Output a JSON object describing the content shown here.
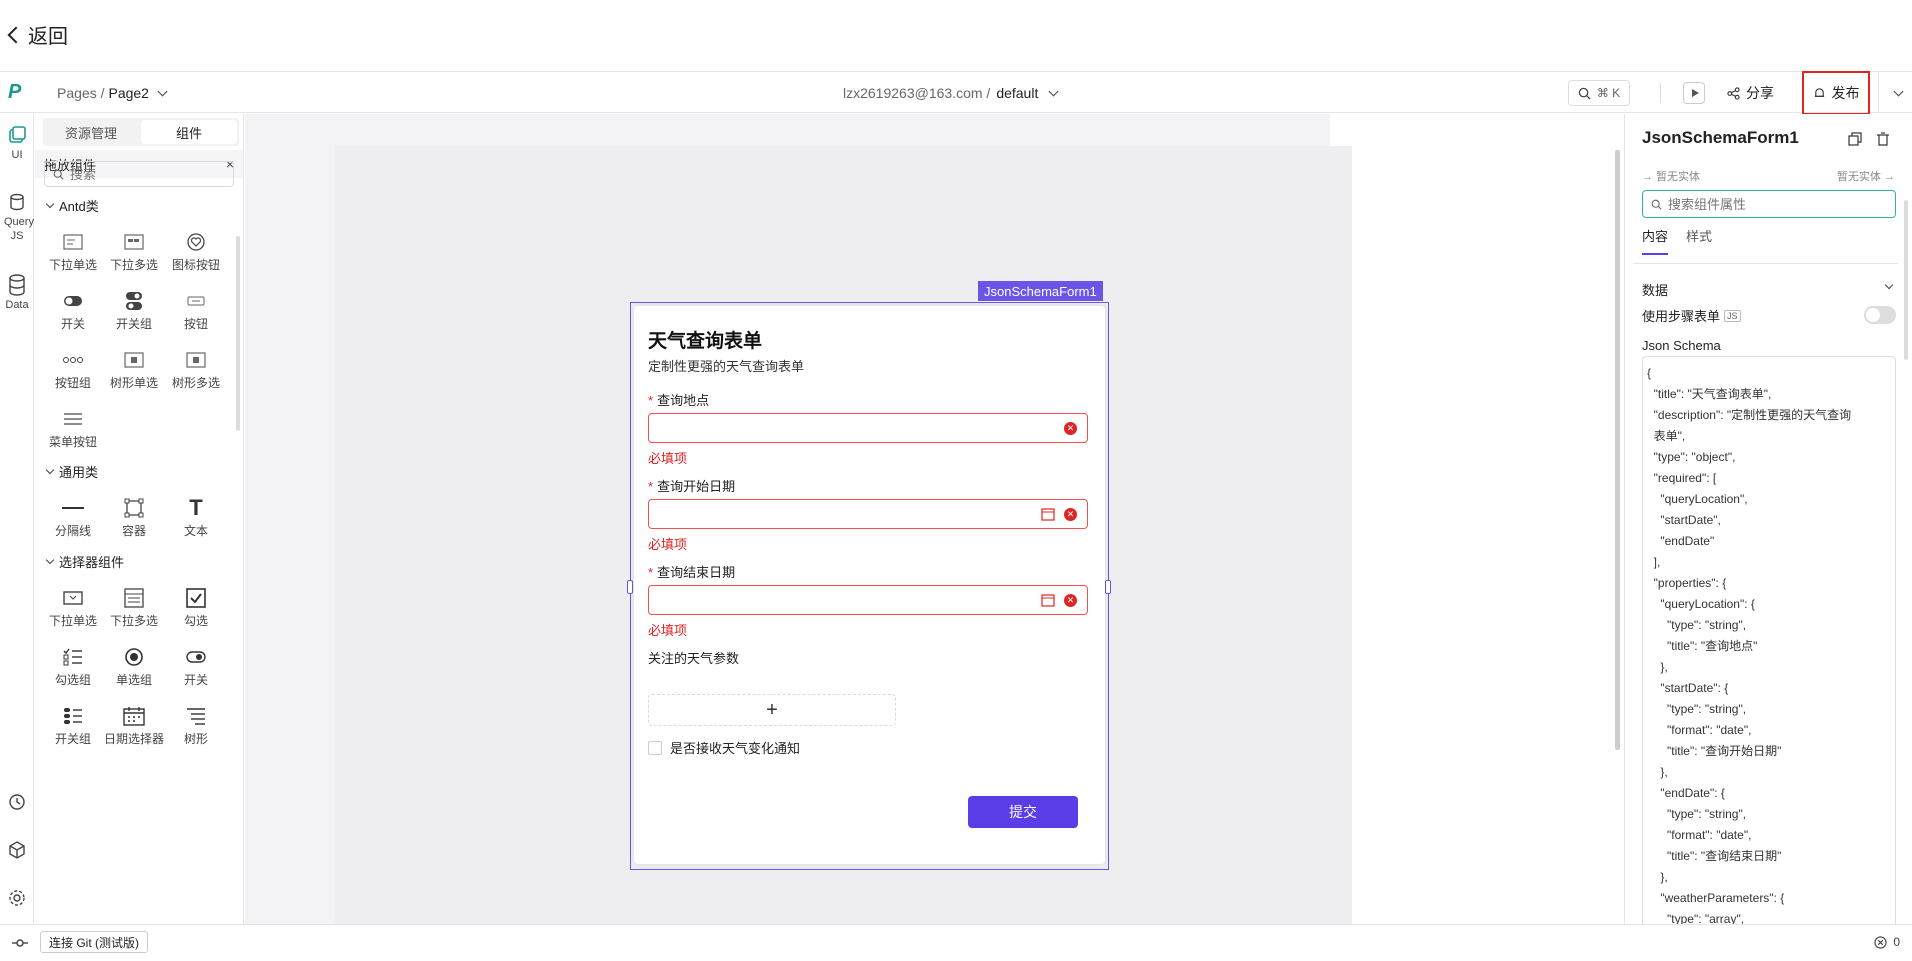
{
  "back": {
    "label": "返回"
  },
  "header": {
    "logo": "P",
    "breadcrumb_root": "Pages /",
    "breadcrumb_page": "Page2",
    "account": "lzx2619263@163.com /",
    "workspace": "default",
    "search_shortcut": "⌘ K",
    "share_label": "分享",
    "publish_label": "发布"
  },
  "rail": {
    "items": [
      {
        "label": "UI"
      },
      {
        "label": "Query JS"
      },
      {
        "label": "Data"
      }
    ]
  },
  "panel": {
    "tabs": [
      {
        "label": "资源管理"
      },
      {
        "label": "组件"
      }
    ],
    "title": "拖放组件",
    "close": "×",
    "search_placeholder": "搜索",
    "groups": [
      {
        "label": "Antd类",
        "items": [
          "下拉单选",
          "下拉多选",
          "图标按钮",
          "开关",
          "开关组",
          "按钮",
          "按钮组",
          "树形单选",
          "树形多选",
          "菜单按钮"
        ]
      },
      {
        "label": "通用类",
        "items": [
          "分隔线",
          "容器",
          "文本"
        ]
      },
      {
        "label": "选择器组件",
        "items": [
          "下拉单选",
          "下拉多选",
          "勾选",
          "勾选组",
          "单选组",
          "开关",
          "开关组",
          "日期选择器",
          "树形"
        ]
      }
    ]
  },
  "canvas": {
    "selected_tag": "JsonSchemaForm1",
    "form": {
      "title": "天气查询表单",
      "description": "定制性更强的天气查询表单",
      "fields": [
        {
          "label": "查询地点",
          "required_mark": "*",
          "error": "必填项"
        },
        {
          "label": "查询开始日期",
          "required_mark": "*",
          "error": "必填项"
        },
        {
          "label": "查询结束日期",
          "required_mark": "*",
          "error": "必填项"
        }
      ],
      "array_label": "关注的天气参数",
      "add_symbol": "+",
      "checkbox_label": "是否接收天气变化通知",
      "submit_label": "提交"
    }
  },
  "inspector": {
    "title": "JsonSchemaForm1",
    "entity_left": "暂无实体",
    "entity_right": "暂无实体",
    "search_placeholder": "搜索组件属性",
    "tabs": [
      {
        "label": "内容"
      },
      {
        "label": "样式"
      }
    ],
    "section": "数据",
    "step_form_label": "使用步骤表单",
    "js_badge": "JS",
    "json_schema_label": "Json Schema",
    "json_schema_value": "{\n  \"title\": \"天气查询表单\",\n  \"description\": \"定制性更强的天气查询\n  表单\",\n  \"type\": \"object\",\n  \"required\": [\n    \"queryLocation\",\n    \"startDate\",\n    \"endDate\"\n  ],\n  \"properties\": {\n    \"queryLocation\": {\n      \"type\": \"string\",\n      \"title\": \"查询地点\"\n    },\n    \"startDate\": {\n      \"type\": \"string\",\n      \"format\": \"date\",\n      \"title\": \"查询开始日期\"\n    },\n    \"endDate\": {\n      \"type\": \"string\",\n      \"format\": \"date\",\n      \"title\": \"查询结束日期\"\n    },\n    \"weatherParameters\": {\n      \"type\": \"array\","
  },
  "status": {
    "git_label": "连接 Git (测试版)",
    "error_count": "0"
  }
}
